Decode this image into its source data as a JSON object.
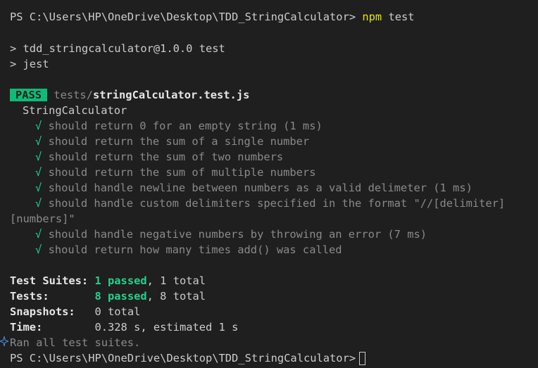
{
  "terminal": {
    "prompt": "PS C:\\Users\\HP\\OneDrive\\Desktop\\TDD_StringCalculator>",
    "command_name": "npm",
    "command_args": "test",
    "script_line_1": "> tdd_stringcalculator@1.0.0 test",
    "script_line_2": "> jest",
    "pass_badge": "PASS",
    "test_path_dir": "tests/",
    "test_path_file": "stringCalculator.test.js",
    "suite_name": "StringCalculator",
    "tick": "√",
    "tests": [
      "should return 0 for an empty string (1 ms)",
      "should return the sum of a single number",
      "should return the sum of two numbers",
      "should return the sum of multiple numbers",
      "should handle newline between numbers as a valid delimeter (1 ms)",
      "should handle custom delimiters specified in the format \"//[delimiter]",
      "[numbers]\"",
      "should handle negative numbers by throwing an error (7 ms)",
      "should return how many times add() was called"
    ],
    "summary": {
      "suites_label": "Test Suites:",
      "suites_passed": "1 passed",
      "suites_total": ", 1 total",
      "tests_label": "Tests:",
      "tests_passed": "8 passed",
      "tests_total": ", 8 total",
      "snapshots_label": "Snapshots:",
      "snapshots_value": "0 total",
      "time_label": "Time:",
      "time_value": "0.328 s, estimated 1 s",
      "ran_all": "Ran all test suites."
    },
    "final_prompt": "PS C:\\Users\\HP\\OneDrive\\Desktop\\TDD_StringCalculator>"
  },
  "colors": {
    "background": "#1f1f1f",
    "text": "#cccccc",
    "command_yellow": "#e5e510",
    "pass_green": "#23d18b",
    "badge_bg": "#0dbc79",
    "dim": "#8a8a8a"
  },
  "icons": {
    "gutter_icon": "sparkle-icon"
  }
}
